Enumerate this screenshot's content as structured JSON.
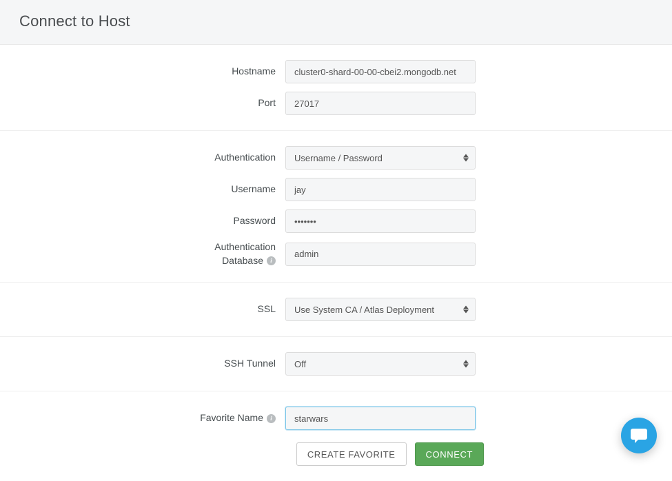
{
  "header": {
    "title": "Connect to Host"
  },
  "fields": {
    "hostname": {
      "label": "Hostname",
      "value": "cluster0-shard-00-00-cbei2.mongodb.net"
    },
    "port": {
      "label": "Port",
      "value": "27017"
    },
    "authentication": {
      "label": "Authentication",
      "value": "Username / Password"
    },
    "username": {
      "label": "Username",
      "value": "jay"
    },
    "password": {
      "label": "Password",
      "value": "•••••••"
    },
    "authdb": {
      "label_line1": "Authentication",
      "label_line2": "Database",
      "value": "admin"
    },
    "ssl": {
      "label": "SSL",
      "value": "Use System CA / Atlas Deployment"
    },
    "sshtunnel": {
      "label": "SSH Tunnel",
      "value": "Off"
    },
    "favorite": {
      "label": "Favorite Name",
      "value": "starwars"
    }
  },
  "buttons": {
    "create_favorite": "CREATE FAVORITE",
    "connect": "CONNECT"
  }
}
